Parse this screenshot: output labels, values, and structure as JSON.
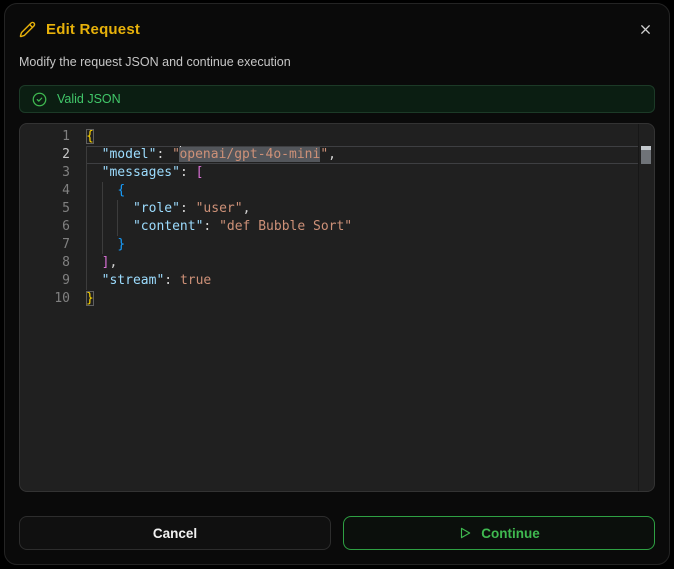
{
  "dialog": {
    "title": "Edit Request",
    "subtitle": "Modify the request JSON and continue execution",
    "accent_color": "#e7b10a"
  },
  "status": {
    "label": "Valid JSON",
    "color": "#3fb950"
  },
  "editor": {
    "language": "json",
    "active_line": 2,
    "selected_text": "openai/gpt-4o-mini",
    "lines": [
      {
        "num": "1",
        "tokens": [
          [
            "b1 match",
            "{"
          ]
        ]
      },
      {
        "num": "2",
        "current": true,
        "tokens": [
          [
            "ws",
            "  "
          ],
          [
            "key",
            "\"model\""
          ],
          [
            "punc",
            ": "
          ],
          [
            "str",
            "\""
          ],
          [
            "cursor",
            ""
          ],
          [
            "str sel",
            "openai/gpt-4o-mini"
          ],
          [
            "str",
            "\""
          ],
          [
            "punc",
            ","
          ]
        ]
      },
      {
        "num": "3",
        "tokens": [
          [
            "ws",
            "  "
          ],
          [
            "key",
            "\"messages\""
          ],
          [
            "punc",
            ": "
          ],
          [
            "b2",
            "["
          ]
        ]
      },
      {
        "num": "4",
        "tokens": [
          [
            "ws",
            "    "
          ],
          [
            "b3",
            "{"
          ]
        ]
      },
      {
        "num": "5",
        "tokens": [
          [
            "ws",
            "      "
          ],
          [
            "key",
            "\"role\""
          ],
          [
            "punc",
            ": "
          ],
          [
            "str",
            "\"user\""
          ],
          [
            "punc",
            ","
          ]
        ]
      },
      {
        "num": "6",
        "tokens": [
          [
            "ws",
            "      "
          ],
          [
            "key",
            "\"content\""
          ],
          [
            "punc",
            ": "
          ],
          [
            "str",
            "\"def Bubble Sort\""
          ]
        ]
      },
      {
        "num": "7",
        "tokens": [
          [
            "ws",
            "    "
          ],
          [
            "b3",
            "}"
          ]
        ]
      },
      {
        "num": "8",
        "tokens": [
          [
            "ws",
            "  "
          ],
          [
            "b2",
            "]"
          ],
          [
            "punc",
            ","
          ]
        ]
      },
      {
        "num": "9",
        "tokens": [
          [
            "ws",
            "  "
          ],
          [
            "key",
            "\"stream\""
          ],
          [
            "punc",
            ": "
          ],
          [
            "bool",
            "true"
          ]
        ]
      },
      {
        "num": "10",
        "tokens": [
          [
            "b1 match",
            "}"
          ]
        ]
      }
    ],
    "guides": [
      {
        "col": 0,
        "from": 2,
        "to": 9
      },
      {
        "col": 2,
        "from": 4,
        "to": 7
      },
      {
        "col": 4,
        "from": 5,
        "to": 6
      }
    ],
    "syntax_colors": {
      "key": "#9cdcfe",
      "string": "#ce9178",
      "boolean": "#ce9178",
      "bracket_l1": "#ffd700",
      "bracket_l2": "#da70d6",
      "bracket_l3": "#179fff",
      "selection_bg": "#53565b"
    }
  },
  "footer": {
    "cancel_label": "Cancel",
    "continue_label": "Continue"
  }
}
